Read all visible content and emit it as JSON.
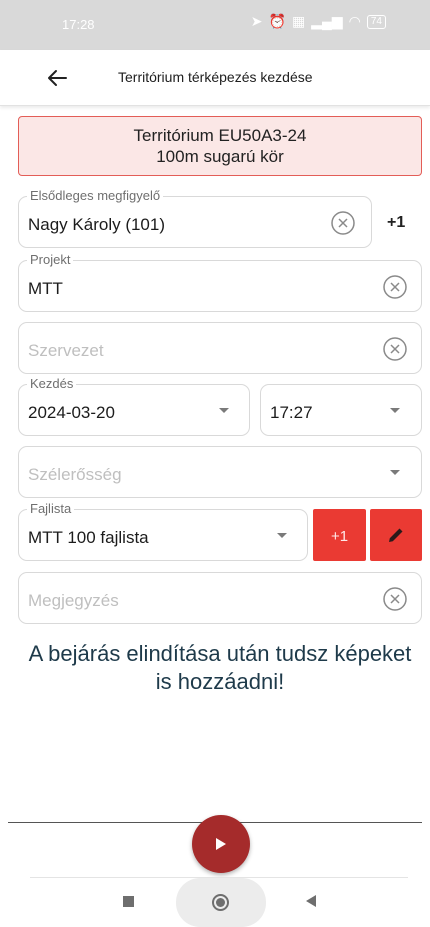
{
  "status_bar": {
    "time": "17:28",
    "battery": "74",
    "icons": [
      "location-icon",
      "alarm-icon",
      "image-notification-icon",
      "signal-icon",
      "wifi-icon",
      "battery-icon"
    ]
  },
  "app_bar": {
    "title": "Territórium térképezés kezdése",
    "back_icon": "arrow-left-icon"
  },
  "banner": {
    "line1": "Territórium EU50A3-24",
    "line2": "100m sugarú kör",
    "background": "#fbe7e6",
    "border": "#e35d57"
  },
  "form": {
    "primary_observer": {
      "label": "Elsődleges megfigyelő",
      "value": "Nagy Károly (101)",
      "extra": "+1"
    },
    "project": {
      "label": "Projekt",
      "value": "MTT"
    },
    "organization": {
      "placeholder": "Szervezet"
    },
    "start": {
      "label": "Kezdés",
      "date": "2024-03-20",
      "time": "17:27"
    },
    "wind": {
      "placeholder": "Szélerősség"
    },
    "species_list": {
      "label": "Fajlista",
      "value": "MTT 100 fajlista",
      "plus_button": "+1",
      "edit_icon": "pencil-icon"
    },
    "note": {
      "placeholder": "Megjegyzés"
    }
  },
  "info": {
    "text": "A bejárás elindítása után tudsz képeket is hozzáadni!"
  },
  "fab": {
    "icon": "play-icon",
    "color": "#a52b2b"
  },
  "accent_color": "#ea3a33"
}
